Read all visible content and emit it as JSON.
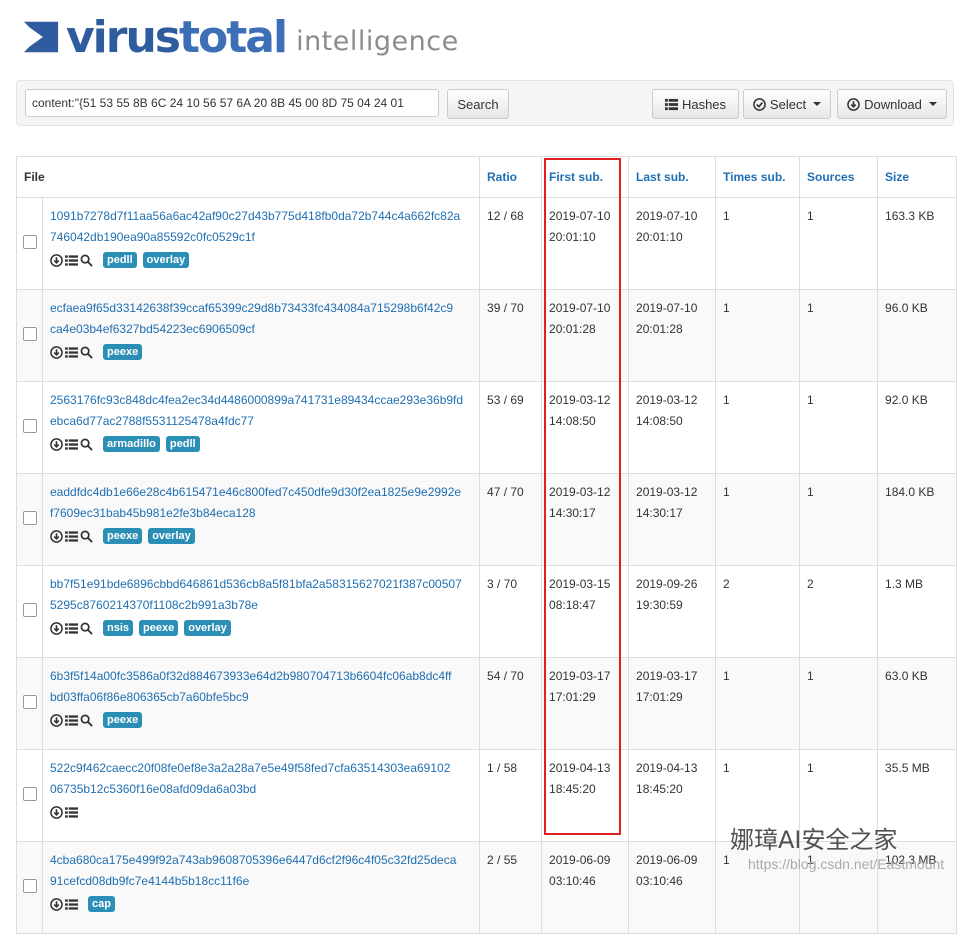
{
  "brand": {
    "name_bold": "virus",
    "name_light": "total",
    "product": "intelligence"
  },
  "search": {
    "query": "content:\"{51 53 55 8B 6C 24 10 56 57 6A 20 8B 45 00 8D 75 04 24 01",
    "button": "Search"
  },
  "toolbar": {
    "hashes": "Hashes",
    "select": "Select",
    "download": "Download"
  },
  "columns": {
    "file": "File",
    "ratio": "Ratio",
    "first_sub": "First sub.",
    "last_sub": "Last sub.",
    "times_sub": "Times sub.",
    "sources": "Sources",
    "size": "Size"
  },
  "rows": [
    {
      "hash1": "1091b7278d7f11aa56a6ac42af90c27d43b775d418fb0da72b744c4a662fc82a",
      "hash2": "746042db190ea90a85592c0fc0529c1f",
      "has_search": true,
      "tags": [
        "pedll",
        "overlay"
      ],
      "ratio": "12 / 68",
      "first_date": "2019-07-10",
      "first_time": "20:01:10",
      "last_date": "2019-07-10",
      "last_time": "20:01:10",
      "times": "1",
      "sources": "1",
      "size": "163.3 KB"
    },
    {
      "hash1": "ecfaea9f65d33142638f39ccaf65399c29d8b73433fc434084a715298b6f42c9",
      "hash2": "ca4e03b4ef6327bd54223ec6906509cf",
      "has_search": true,
      "tags": [
        "peexe"
      ],
      "ratio": "39 / 70",
      "first_date": "2019-07-10",
      "first_time": "20:01:28",
      "last_date": "2019-07-10",
      "last_time": "20:01:28",
      "times": "1",
      "sources": "1",
      "size": "96.0 KB"
    },
    {
      "hash1": "2563176fc93c848dc4fea2ec34d4486000899a741731e89434ccae293e36b9fd",
      "hash2": "ebca6d77ac2788f5531125478a4fdc77",
      "has_search": true,
      "tags": [
        "armadillo",
        "pedll"
      ],
      "ratio": "53 / 69",
      "first_date": "2019-03-12",
      "first_time": "14:08:50",
      "last_date": "2019-03-12",
      "last_time": "14:08:50",
      "times": "1",
      "sources": "1",
      "size": "92.0 KB"
    },
    {
      "hash1": "eaddfdc4db1e66e28c4b615471e46c800fed7c450dfe9d30f2ea1825e9e2992e",
      "hash2": "f7609ec31bab45b981e2fe3b84eca128",
      "has_search": true,
      "tags": [
        "peexe",
        "overlay"
      ],
      "ratio": "47 / 70",
      "first_date": "2019-03-12",
      "first_time": "14:30:17",
      "last_date": "2019-03-12",
      "last_time": "14:30:17",
      "times": "1",
      "sources": "1",
      "size": "184.0 KB"
    },
    {
      "hash1": "bb7f51e91bde6896cbbd646861d536cb8a5f81bfa2a58315627021f387c00507",
      "hash2": "5295c8760214370f1108c2b991a3b78e",
      "has_search": true,
      "tags": [
        "nsis",
        "peexe",
        "overlay"
      ],
      "ratio": "3 / 70",
      "first_date": "2019-03-15",
      "first_time": "08:18:47",
      "last_date": "2019-09-26",
      "last_time": "19:30:59",
      "times": "2",
      "sources": "2",
      "size": "1.3 MB"
    },
    {
      "hash1": "6b3f5f14a00fc3586a0f32d884673933e64d2b980704713b6604fc06ab8dc4ff",
      "hash2": "bd03ffa06f86e806365cb7a60bfe5bc9",
      "has_search": true,
      "tags": [
        "peexe"
      ],
      "ratio": "54 / 70",
      "first_date": "2019-03-17",
      "first_time": "17:01:29",
      "last_date": "2019-03-17",
      "last_time": "17:01:29",
      "times": "1",
      "sources": "1",
      "size": "63.0 KB"
    },
    {
      "hash1": "522c9f462caecc20f08fe0ef8e3a2a28a7e5e49f58fed7cfa63514303ea69102",
      "hash2": "06735b12c5360f16e08afd09da6a03bd",
      "has_search": false,
      "tags": [],
      "ratio": "1 / 58",
      "first_date": "2019-04-13",
      "first_time": "18:45:20",
      "last_date": "2019-04-13",
      "last_time": "18:45:20",
      "times": "1",
      "sources": "1",
      "size": "35.5 MB"
    },
    {
      "hash1": "4cba680ca175e499f92a743ab9608705396e6447d6cf2f96c4f05c32fd25deca",
      "hash2": "91cefcd08db9fc7e4144b5b18cc11f6e",
      "has_search": false,
      "tags": [
        "cap"
      ],
      "ratio": "2 / 55",
      "first_date": "2019-06-09",
      "first_time": "03:10:46",
      "last_date": "2019-06-09",
      "last_time": "03:10:46",
      "times": "1",
      "sources": "1",
      "size": "102.3 MB"
    }
  ],
  "colors": {
    "link": "#1f6fb2",
    "tag": "#2b8fb5",
    "highlight": "#e02020",
    "brand": "#2f5c9e"
  },
  "watermark": {
    "text": "娜璋AI安全之家",
    "url": "https://blog.csdn.net/Eastmount"
  }
}
